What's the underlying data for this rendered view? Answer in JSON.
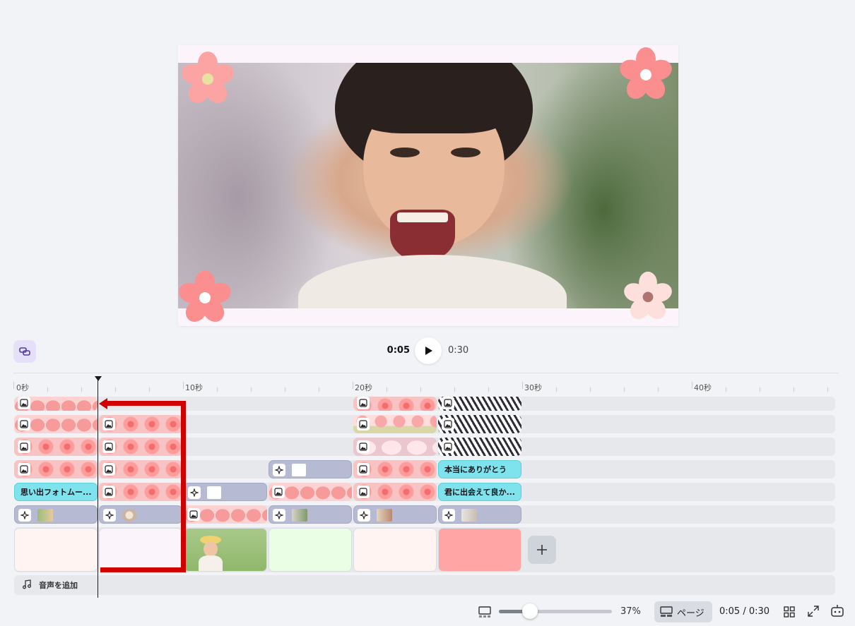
{
  "playback": {
    "current_time": "0:05",
    "total_time": "0:30"
  },
  "ruler": {
    "labels": [
      "0秒",
      "10秒",
      "20秒",
      "30秒",
      "40秒"
    ]
  },
  "tracks": {
    "text_clips": {
      "memories": "思い出フォトムー...",
      "thanks": "本当にありがとう",
      "glad": "君に出会えて良か..."
    }
  },
  "audio": {
    "add_label": "音声を追加"
  },
  "bottom_bar": {
    "zoom_value": "37%",
    "zoom_fraction": 0.37,
    "page_label": "ページ",
    "time_readout": "0:05 / 0:30"
  },
  "colors": {
    "accent_purple": "#e6dffa",
    "clip_grey": "#b6bad2",
    "clip_cyan": "#7ee3ec",
    "annotation_red": "#d10000",
    "page_coral": "#ffa5a5"
  },
  "icons": [
    "link-icon",
    "play-icon",
    "image-icon",
    "sparkle-icon",
    "plus-icon",
    "music-note-icon",
    "layout-icon",
    "grid-icon",
    "fullscreen-icon",
    "assistant-icon"
  ]
}
